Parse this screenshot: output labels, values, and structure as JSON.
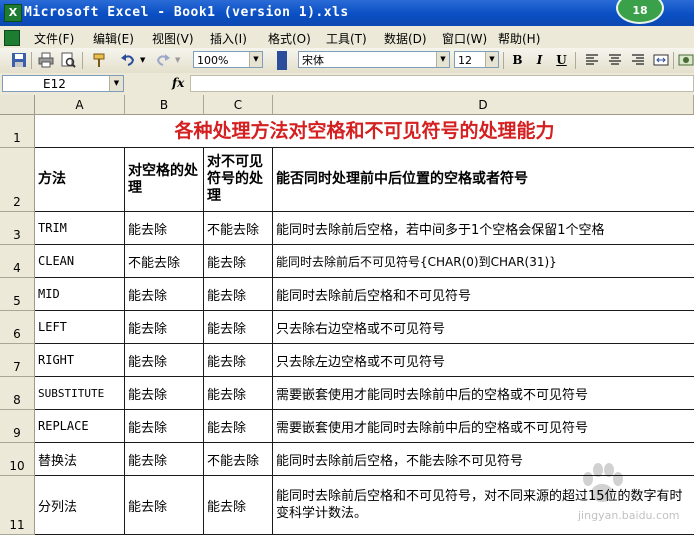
{
  "window": {
    "title": "Microsoft Excel - Book1 (version 1).xls",
    "app_icon": "excel-icon",
    "badge": "18"
  },
  "menu": [
    "文件(F)",
    "编辑(E)",
    "视图(V)",
    "插入(I)",
    "格式(O)",
    "工具(T)",
    "数据(D)",
    "窗口(W)",
    "帮助(H)"
  ],
  "toolbar": {
    "zoom": "100%",
    "font": "宋体",
    "font_size": "12",
    "bold": "B",
    "italic": "I",
    "underline": "U",
    "icons": [
      "save-icon",
      "print-icon",
      "print-preview-icon",
      "format-painter-icon",
      "undo-icon",
      "redo-icon",
      "align-left-icon",
      "align-center-icon",
      "align-right-icon",
      "merge-center-icon"
    ]
  },
  "formula_bar": {
    "name_box": "E12",
    "fx_label": "fx",
    "value": ""
  },
  "columns": [
    "A",
    "B",
    "C",
    "D"
  ],
  "rows": [
    "1",
    "2",
    "3",
    "4",
    "5",
    "6",
    "7",
    "8",
    "9",
    "10",
    "11"
  ],
  "sheet": {
    "title": "各种处理方法对空格和不可见符号的处理能力",
    "headers": [
      "方法",
      "对空格的处理",
      "对不可见符号的处理",
      "能否同时处理前中后位置的空格或者符号"
    ],
    "data": [
      [
        "TRIM",
        "能去除",
        "不能去除",
        "能同时去除前后空格，若中间多于1个空格会保留1个空格"
      ],
      [
        "CLEAN",
        "不能去除",
        "能去除",
        "能同时去除前后不可见符号{CHAR(0)到CHAR(31)}"
      ],
      [
        "MID",
        "能去除",
        "能去除",
        "能同时去除前后空格和不可见符号"
      ],
      [
        "LEFT",
        "能去除",
        "能去除",
        "只去除右边空格或不可见符号"
      ],
      [
        "RIGHT",
        "能去除",
        "能去除",
        "只去除左边空格或不可见符号"
      ],
      [
        "SUBSTITUTE",
        "能去除",
        "能去除",
        "需要嵌套使用才能同时去除前中后的空格或不可见符号"
      ],
      [
        "REPLACE",
        "能去除",
        "能去除",
        "需要嵌套使用才能同时去除前中后的空格或不可见符号"
      ],
      [
        "替换法",
        "能去除",
        "不能去除",
        "能同时去除前后空格，不能去除不可见符号"
      ],
      [
        "分列法",
        "能去除",
        "能去除",
        "能同时去除前后空格和不可见符号，对不同来源的超过15位的数字有时变科学计数法。"
      ]
    ]
  },
  "watermark": {
    "text": "Bai°经验",
    "url": "jingyan.baidu.com"
  }
}
